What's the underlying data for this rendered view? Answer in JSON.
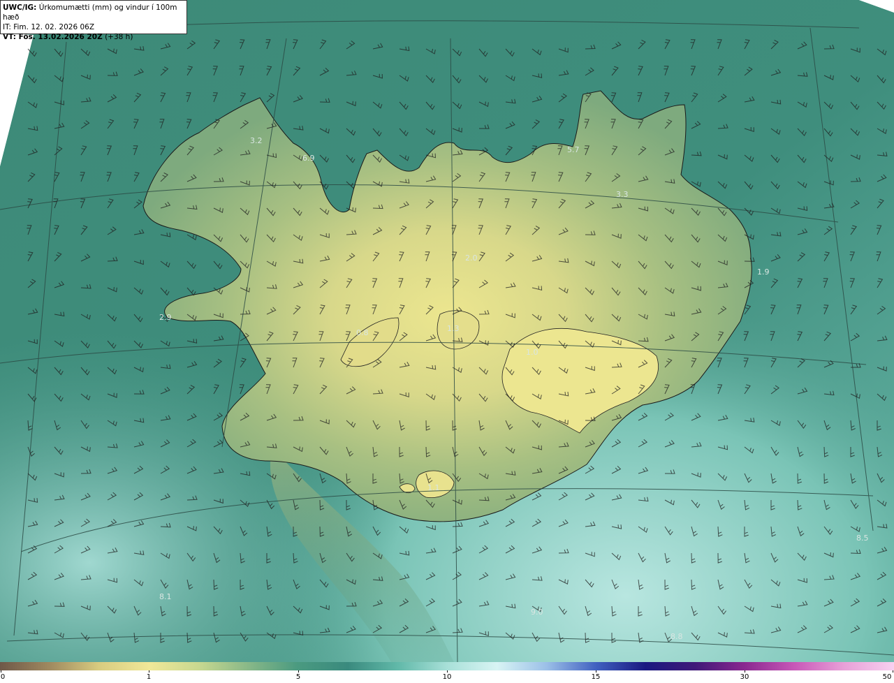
{
  "header": {
    "line1_bold": "UWC/IG:",
    "line1_rest": " Úrkomumætti (mm) og vindur í 100m hæð",
    "line2": "IT: Fim. 12. 02. 2026 06Z",
    "line3_bold": "VT: Fös. 13.02.2026 20Z",
    "line3_rest": " (+38 h)"
  },
  "map_labels": [
    {
      "text": "3.2"
    },
    {
      "text": "6.9"
    },
    {
      "text": "5.7"
    },
    {
      "text": "3.3"
    },
    {
      "text": "2.0"
    },
    {
      "text": "2.9"
    },
    {
      "text": "1.9"
    },
    {
      "text": "0.8"
    },
    {
      "text": "1.3"
    },
    {
      "text": "1.0"
    },
    {
      "text": "1.1"
    },
    {
      "text": "8.5"
    },
    {
      "text": "8.1"
    },
    {
      "text": "9.0"
    },
    {
      "text": "8.8"
    }
  ],
  "colorbar": {
    "ticks": [
      "0",
      "1",
      "5",
      "10",
      "15",
      "30",
      "50"
    ],
    "colors": [
      "#6e5848",
      "#a08a60",
      "#d8cc80",
      "#f0e898",
      "#c8d890",
      "#88b888",
      "#4a9a80",
      "#3a8a7e",
      "#60b8a8",
      "#a8e0d8",
      "#d8f4f4",
      "#9cc0e8",
      "#4060c0",
      "#1a1880",
      "#401878",
      "#8a2890",
      "#c858b8",
      "#e8a0d8",
      "#f8d0f0"
    ]
  },
  "colors": {
    "sea": "#3f8a79",
    "land_high": "#e8e290",
    "land_mid": "#9ab880"
  }
}
